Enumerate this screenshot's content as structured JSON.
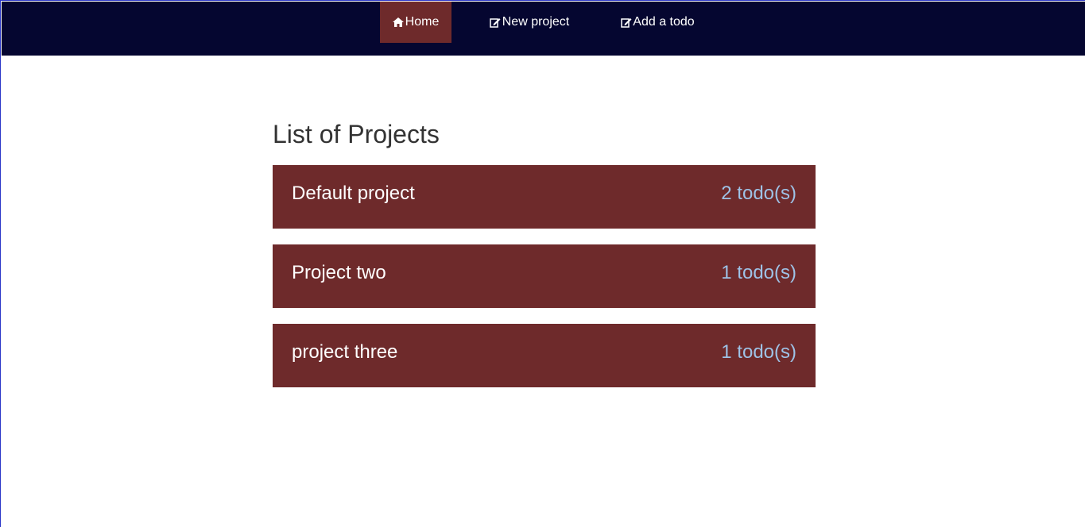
{
  "nav": {
    "items": [
      {
        "label": "Home",
        "icon": "home-icon",
        "active": true
      },
      {
        "label": "New project",
        "icon": "edit-icon",
        "active": false
      },
      {
        "label": "Add a todo",
        "icon": "edit-icon",
        "active": false
      }
    ]
  },
  "main": {
    "title": "List of Projects",
    "projects": [
      {
        "name": "Default project",
        "count": "2 todo(s)"
      },
      {
        "name": "Project two",
        "count": "1 todo(s)"
      },
      {
        "name": "project three",
        "count": "1 todo(s)"
      }
    ]
  },
  "colors": {
    "navbar_bg": "#050630",
    "accent": "#6e2a2b",
    "count_text": "#9ec2e6"
  }
}
